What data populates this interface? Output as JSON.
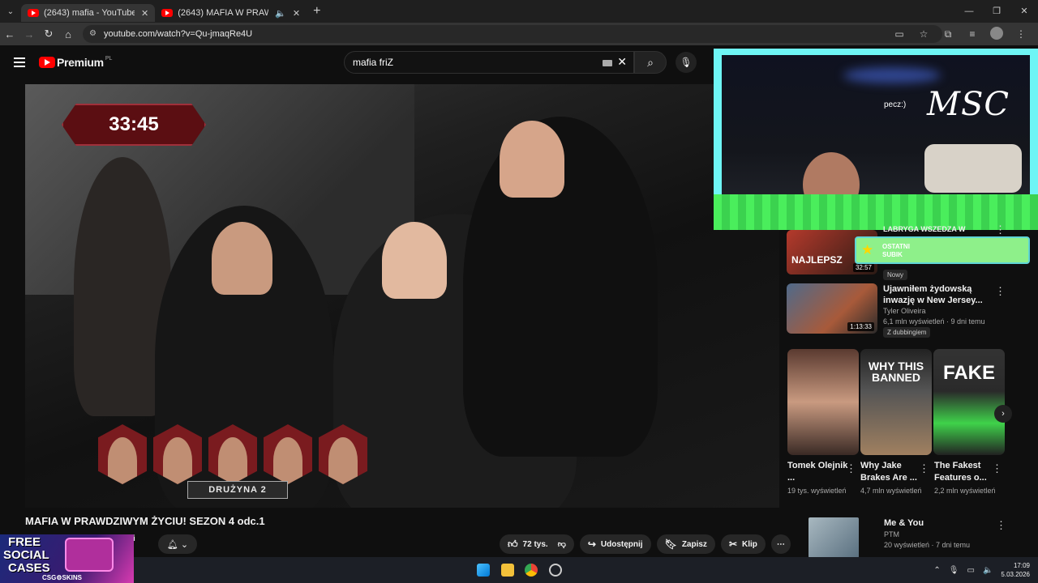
{
  "browser": {
    "tabs": [
      {
        "title": "(2643) mafia - YouTube",
        "active": true
      },
      {
        "title": "(2643) MAFIA W PRAWDZIWY",
        "active": false
      }
    ],
    "url": "youtube.com/watch?v=Qu-jmaqRe4U"
  },
  "youtube": {
    "logo": "Premium",
    "logo_country": "PL",
    "search_value": "mafia friZ"
  },
  "video": {
    "timer": "33:45",
    "team_label": "DRUŻYNA 2",
    "title": "MAFIA W PRAWDZIWYM ŻYCIU! SEZON 4 odc.1",
    "channel_initial": "i",
    "likes": "72 tys.",
    "share": "Udostępnij",
    "save": "Zapisz",
    "clip": "Klip"
  },
  "overlay": {
    "logo": "MSC",
    "chat": "pecz:)",
    "streak_line1": "OSTATNI",
    "streak_line2": "SUBIK"
  },
  "sidebar": {
    "top": {
      "title": "LABRYGA WSZEDZA W",
      "duration": "32:57",
      "thumb_text": "NAJLEPSZ",
      "badge": "Nowy"
    },
    "second": {
      "title": "Ujawniłem żydowską inwazję w New Jersey...",
      "channel": "Tyler Oliveira",
      "meta": "6,1 mln wyświetleń · 9 dni temu",
      "duration": "1:13:33",
      "badge": "Z dubbingiem"
    },
    "shorts": [
      {
        "title": "Tomek Olejnik ...",
        "views": "19 tys. wyświetleń",
        "thumb_text": ""
      },
      {
        "title": "Why Jake Brakes Are ...",
        "views": "4,7 mln wyświetleń",
        "thumb_text": "WHY THIS BANNED"
      },
      {
        "title": "The Fakest Features o...",
        "views": "2,2 mln wyświetleń",
        "thumb_text": "FAKE"
      }
    ],
    "bottom": {
      "title": "Me & You",
      "channel": "PTM",
      "meta": "20 wyświetleń · 7 dni temu"
    }
  },
  "promo": {
    "line1": "FREE",
    "line2": "SOCIAL",
    "line3": "CASES",
    "brand": "CSG⚙SKINS"
  },
  "taskbar": {
    "time": "17:09",
    "date": "5.03.2026"
  }
}
